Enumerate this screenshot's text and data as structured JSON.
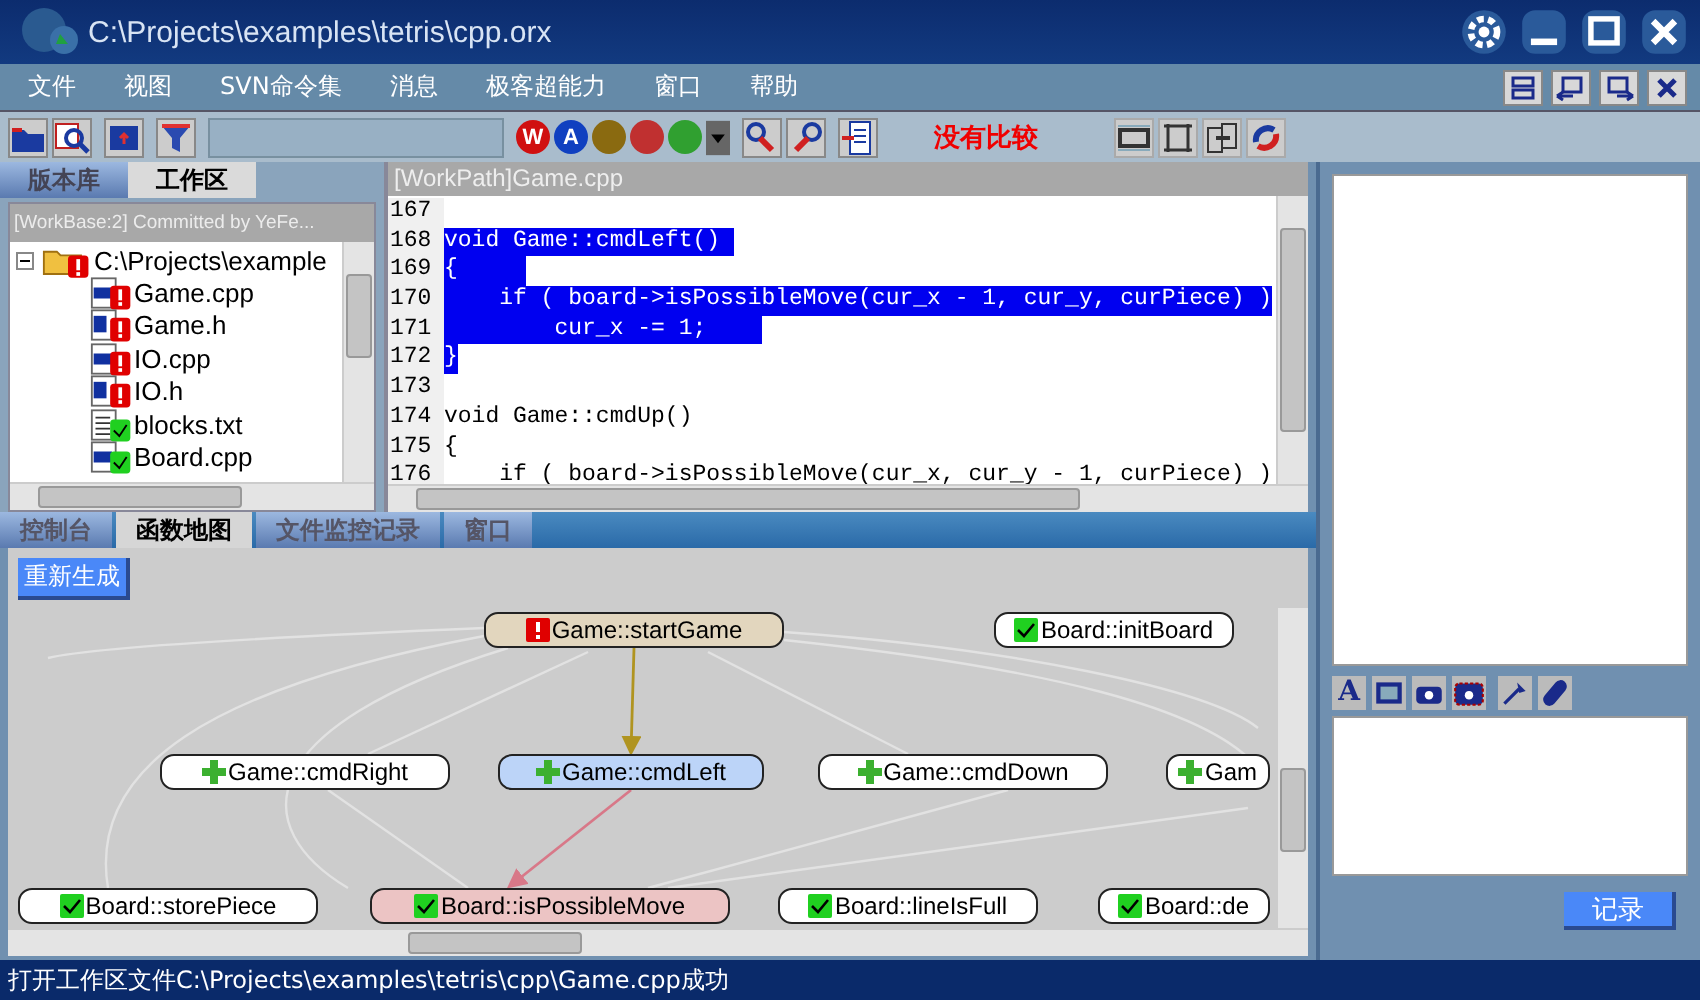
{
  "window": {
    "title": "C:\\Projects\\examples\\tetris\\cpp.orx"
  },
  "menu": [
    "文件",
    "视图",
    "SVN命令集",
    "消息",
    "极客超能力",
    "窗口",
    "帮助"
  ],
  "toolbar": {
    "circle_buttons": [
      {
        "label": "W",
        "color": "#d01010"
      },
      {
        "label": "A",
        "color": "#1040c0"
      },
      {
        "color": "#8a6a10"
      },
      {
        "color": "#c03030"
      },
      {
        "color": "#30a030"
      }
    ],
    "compare_status": "没有比较"
  },
  "repo_tabs": [
    {
      "label": "版本库",
      "selected": false
    },
    {
      "label": "工作区",
      "selected": true
    }
  ],
  "tree": {
    "header": "[WorkBase:2] Committed by YeFe...",
    "items": [
      {
        "label": "C:\\Projects\\example",
        "kind": "folder",
        "modified": true,
        "expanded": true,
        "children": [
          {
            "label": "Game.cpp",
            "kind": "cpp",
            "modified": true
          },
          {
            "label": "Game.h",
            "kind": "h",
            "modified": true
          },
          {
            "label": "IO.cpp",
            "kind": "cpp",
            "modified": true
          },
          {
            "label": "IO.h",
            "kind": "h",
            "modified": true
          },
          {
            "label": "blocks.txt",
            "kind": "txt",
            "modified": false
          },
          {
            "label": "Board.cpp",
            "kind": "cpp",
            "modified": false
          }
        ]
      }
    ]
  },
  "editor": {
    "title": "[WorkPath]Game.cpp",
    "lines": [
      {
        "number": "167",
        "selected": false
      },
      {
        "number": "168",
        "text": "void Game::cmdLeft() ",
        "selected": true
      },
      {
        "number": "169",
        "text": "{     ",
        "selected": true
      },
      {
        "number": "170",
        "text": "    if ( board->isPossibleMove(cur_x - 1, cur_y, curPiece) )",
        "selected": true
      },
      {
        "number": "171",
        "text": "        cur_x -= 1;    ",
        "selected": true
      },
      {
        "number": "172",
        "text": "}",
        "selected": true
      },
      {
        "number": "173",
        "selected": false
      },
      {
        "number": "174",
        "text": "void Game::cmdUp()",
        "selected": false
      },
      {
        "number": "175",
        "text": "{",
        "selected": false
      },
      {
        "number": "176",
        "text": "    if ( board->isPossibleMove(cur_x, cur_y - 1, curPiece) )",
        "selected": false
      }
    ]
  },
  "bottom_tabs": [
    {
      "label": "控制台",
      "selected": false
    },
    {
      "label": "函数地图",
      "selected": true
    },
    {
      "label": "文件监控记录",
      "selected": false
    },
    {
      "label": "窗口",
      "selected": false
    }
  ],
  "graph": {
    "regenerate_button": "重新生成",
    "nodes": [
      {
        "label": "Game::startGame",
        "kind": "error",
        "color": "#e2d6be"
      },
      {
        "label": "Board::initBoard",
        "kind": "ok",
        "color": "#ffffff"
      },
      {
        "label": "Game::cmdRight",
        "kind": "added",
        "color": "#ffffff"
      },
      {
        "label": "Game::cmdLeft",
        "kind": "added",
        "color": "#bcd4f8"
      },
      {
        "label": "Game::cmdDown",
        "kind": "added",
        "color": "#ffffff"
      },
      {
        "label": "Gam",
        "kind": "added",
        "color": "#ffffff"
      },
      {
        "label": "Board::storePiece",
        "kind": "ok",
        "color": "#ffffff"
      },
      {
        "label": "Board::isPossibleMove",
        "kind": "ok",
        "color": "#ecc4c4"
      },
      {
        "label": "Board::lineIsFull",
        "kind": "ok",
        "color": "#ffffff"
      },
      {
        "label": "Board::de",
        "kind": "ok",
        "color": "#ffffff"
      }
    ],
    "edges": [
      {
        "color": "#b09420"
      },
      {
        "color": "#d87888"
      }
    ]
  },
  "right_panel": {
    "format_button": "A",
    "record_button": "记录"
  },
  "status_bar": "打开工作区文件C:\\Projects\\examples\\tetris\\cpp\\Game.cpp成功"
}
